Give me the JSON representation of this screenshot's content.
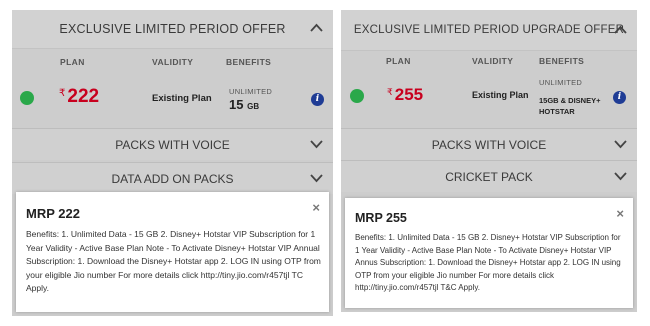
{
  "left": {
    "header": "EXCLUSIVE LIMITED PERIOD OFFER",
    "columns": {
      "plan": "PLAN",
      "validity": "VALIDITY",
      "benefits": "BENEFITS"
    },
    "plan": {
      "currency": "₹",
      "price": "222",
      "validity": "Existing Plan",
      "benefit_small": "UNLIMITED",
      "benefit_big": "15",
      "benefit_unit": "GB"
    },
    "rows": [
      "PACKS WITH VOICE",
      "DATA ADD ON PACKS"
    ],
    "modal": {
      "title": "MRP 222",
      "close": "×",
      "body": "Benefits: 1. Unlimited Data - 15 GB 2. Disney+ Hotstar VIP Subscription for 1 Year Validity - Active Base Plan Note - To Activate Disney+ Hotstar VIP Annual Subscription: 1. Download the Disney+ Hotstar app 2. LOG IN using OTP from your eligible Jio number For more details click http://tiny.jio.com/r457tjl TC Apply."
    }
  },
  "right": {
    "header": "EXCLUSIVE LIMITED PERIOD UPGRADE OFFER",
    "columns": {
      "plan": "PLAN",
      "validity": "VALIDITY",
      "benefits": "BENEFITS"
    },
    "plan": {
      "currency": "₹",
      "price": "255",
      "validity": "Existing Plan",
      "benefit_small": "UNLIMITED",
      "benefit_line1": "15GB & DISNEY+",
      "benefit_line2": "HOTSTAR"
    },
    "rows": [
      "PACKS WITH VOICE",
      "CRICKET PACK"
    ],
    "modal": {
      "title": "MRP 255",
      "close": "×",
      "body": "Benefits: 1. Unlimited Data - 15 GB 2. Disney+ Hotstar VIP Subscription for 1 Year Validity - Active Base Plan Note - To Activate Disney+ Hotstar VIP Annus Subscription: 1. Download the Disney+ Hotstar app 2. LOG IN using OTP from your eligible Jio number For more details click http://tiny.jio.com/r457tjl T&C Apply."
    }
  },
  "colors": {
    "price": "#c8001e",
    "active_dot": "#2aa84a",
    "info_icon": "#1f3c95",
    "panel_bg": "#cdcdcd"
  },
  "icons": [
    "chevron-up-icon",
    "chevron-down-icon",
    "active-plan-dot-icon",
    "info-icon",
    "close-icon"
  ]
}
